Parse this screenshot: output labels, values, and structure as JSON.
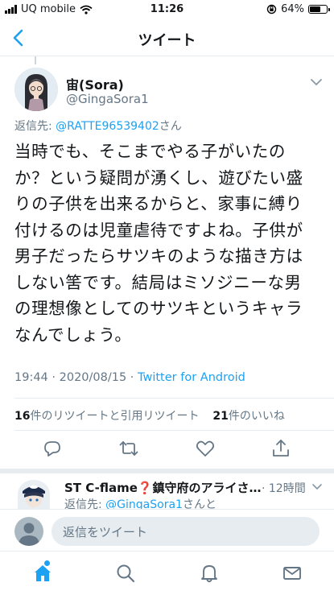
{
  "status_bar": {
    "carrier": "UQ mobile",
    "time": "11:26",
    "battery": "64%",
    "battery_level": 0.64
  },
  "nav": {
    "title": "ツイート"
  },
  "tweet": {
    "display_name": "宙(Sora)",
    "handle": "@GingaSora1",
    "reply_prefix": "返信先: ",
    "reply_mention": "@RATTE96539402",
    "reply_suffix": "さん",
    "lines": [
      "当時でも、そこまでやる子がいたの",
      "か？という疑問が湧くし、遊びたい盛",
      "りの子供を出来るからと、家事に縛り",
      "付けるのは児童虐待ですよね。子供が",
      "男子だったらサツキのような描き方は",
      "しない筈です。結局はミソジニーな男",
      "の理想像としてのサツキというキャラ",
      "なんでしょう。"
    ],
    "timestamp": "19:44 · 2020/08/15 · ",
    "source": "Twitter for Android",
    "retweets_count": "16",
    "retweets_label": "件のリツイートと引用リツイート",
    "likes_count": "21",
    "likes_label": "件のいいね"
  },
  "reply": {
    "display_name": "ST C-flame❓鎮守府のアライさ…",
    "time": "· 12時間",
    "reply_prefix": "返信先: ",
    "reply_mention": "@GingaSora1",
    "reply_suffix": "さんと"
  },
  "compose": {
    "placeholder": "返信をツイート"
  },
  "colors": {
    "accent": "#1da1f2",
    "secondary_text": "#657786",
    "divider": "#e6ecf0"
  },
  "icons": [
    "back-arrow-icon",
    "wifi-icon",
    "rotation-lock-icon",
    "battery-icon",
    "chevron-down-icon",
    "reply-icon",
    "retweet-icon",
    "like-icon",
    "share-icon",
    "home-icon",
    "search-icon",
    "notifications-icon",
    "messages-icon"
  ]
}
